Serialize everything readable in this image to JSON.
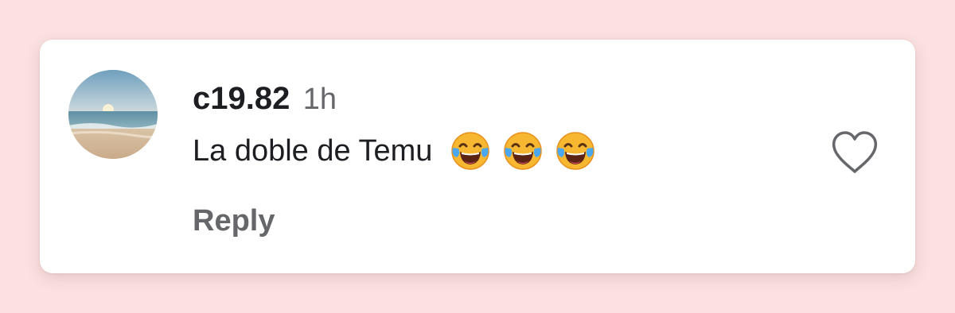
{
  "comment": {
    "author": "c19.82",
    "timestamp": "1h",
    "text": "La doble de Temu",
    "emojis": [
      "face-with-tears-of-joy",
      "face-with-tears-of-joy",
      "face-with-tears-of-joy"
    ],
    "reply_label": "Reply",
    "like_icon": "heart-outline-icon",
    "avatar_icon": "beach-sunset-avatar"
  },
  "colors": {
    "background": "#fbe1e1",
    "card": "#ffffff",
    "text_primary": "#1c1e21",
    "text_secondary": "#65676b"
  }
}
